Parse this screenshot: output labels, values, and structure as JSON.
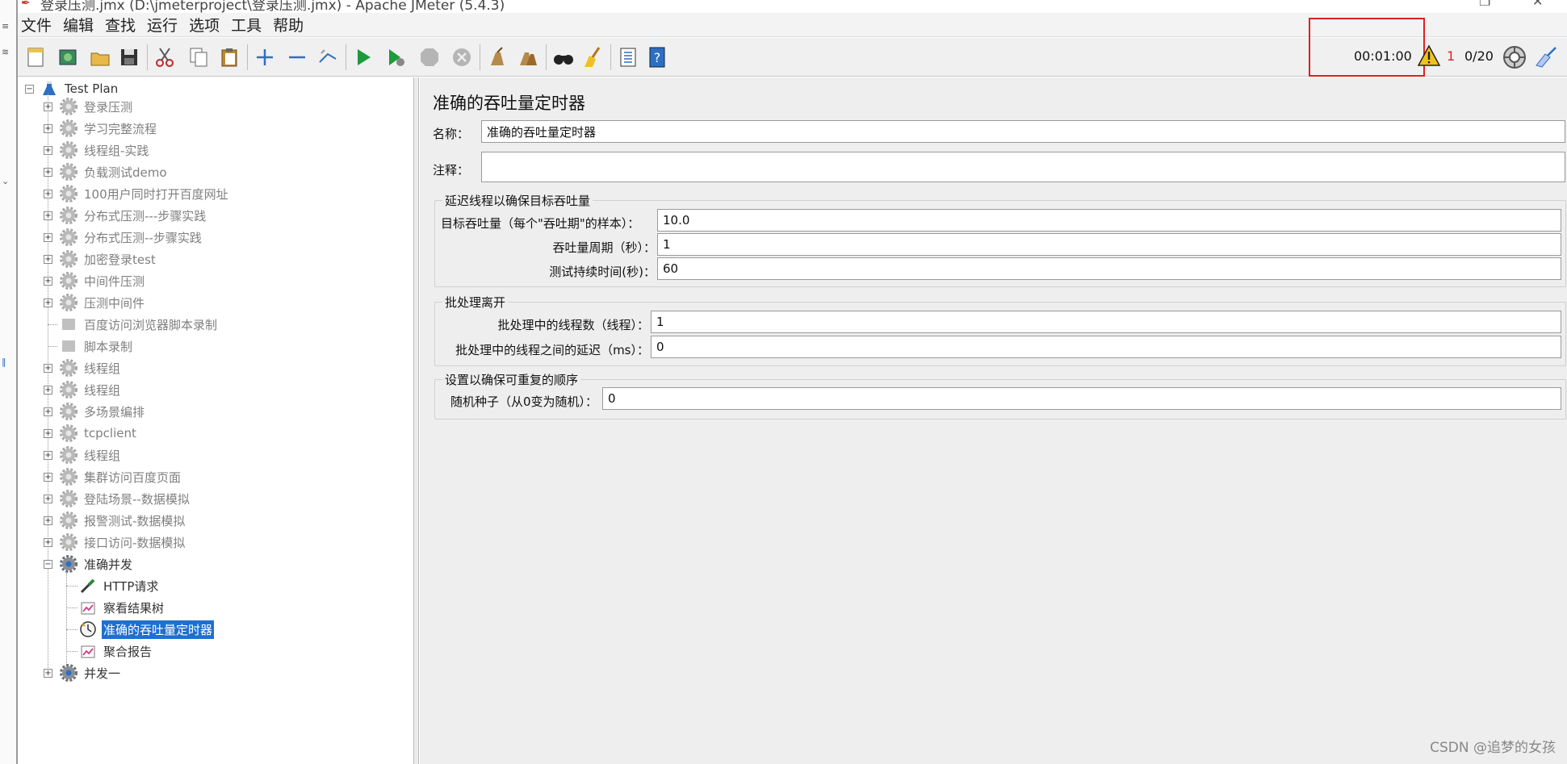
{
  "window": {
    "title": "登录压测.jmx (D:\\jmeterproject\\登录压测.jmx) - Apache JMeter (5.4.3)"
  },
  "menu": [
    "文件",
    "编辑",
    "查找",
    "运行",
    "选项",
    "工具",
    "帮助"
  ],
  "toolbar": {
    "buttons": [
      "new-icon",
      "templates-icon",
      "open-icon",
      "save-icon",
      "cut-icon",
      "copy-icon",
      "paste-icon",
      "expand-icon",
      "collapse-icon",
      "toggle-icon",
      "start-icon",
      "start-no-pause-icon",
      "stop-icon",
      "shutdown-icon",
      "clear-icon",
      "clear-all-icon",
      "search-icon",
      "reset-search-icon",
      "function-helper-icon",
      "help-icon"
    ],
    "timer": "00:01:00",
    "warning_count": "1",
    "threads": "0/20",
    "highlight_color": "#e02020"
  },
  "tree": {
    "root": "Test Plan",
    "items": [
      {
        "label": "登录压测",
        "disabled": true
      },
      {
        "label": "学习完整流程",
        "disabled": true
      },
      {
        "label": "线程组-实践",
        "disabled": true
      },
      {
        "label": "负载测试demo",
        "disabled": true
      },
      {
        "label": "100用户同时打开百度网址",
        "disabled": true
      },
      {
        "label": "分布式压测---步骤实践",
        "disabled": true
      },
      {
        "label": "分布式压测--步骤实践",
        "disabled": true
      },
      {
        "label": "加密登录test",
        "disabled": true
      },
      {
        "label": "中间件压测",
        "disabled": true
      },
      {
        "label": "压测中间件",
        "disabled": true
      },
      {
        "label": "百度访问浏览器脚本录制",
        "disabled": true
      },
      {
        "label": "脚本录制",
        "disabled": true
      },
      {
        "label": "线程组",
        "disabled": true
      },
      {
        "label": "线程组",
        "disabled": true
      },
      {
        "label": "多场景编排",
        "disabled": true
      },
      {
        "label": "tcpclient",
        "disabled": true
      },
      {
        "label": "线程组",
        "disabled": true
      },
      {
        "label": "集群访问百度页面",
        "disabled": true
      },
      {
        "label": "登陆场景--数据模拟",
        "disabled": true
      },
      {
        "label": "报警测试-数据模拟",
        "disabled": true
      },
      {
        "label": "接口访问-数据模拟",
        "disabled": true
      },
      {
        "label": "准确并发",
        "disabled": false
      }
    ],
    "children": [
      "HTTP请求",
      "察看结果树",
      "准确的吞吐量定时器",
      "聚合报告"
    ],
    "selected_child": "准确的吞吐量定时器",
    "last": "并发一"
  },
  "form": {
    "title": "准确的吞吐量定时器",
    "name_label": "名称：",
    "name_value": "准确的吞吐量定时器",
    "comment_label": "注释：",
    "comment_value": "",
    "group1": {
      "title": "延迟线程以确保目标吞吐量",
      "target_label": "目标吞吐量（每个\"吞吐期\"的样本）：",
      "target_value": "10.0",
      "period_label": "吞吐量周期（秒）：",
      "period_value": "1",
      "duration_label": "测试持续时间(秒)：",
      "duration_value": "60"
    },
    "group2": {
      "title": "批处理离开",
      "threads_label": "批处理中的线程数（线程）：",
      "threads_value": "1",
      "delay_label": "批处理中的线程之间的延迟（ms）：",
      "delay_value": "0"
    },
    "group3": {
      "title": "设置以确保可重复的顺序",
      "seed_label": "随机种子（从0变为随机）：",
      "seed_value": "0"
    }
  },
  "watermark": "CSDN @追梦的女孩"
}
